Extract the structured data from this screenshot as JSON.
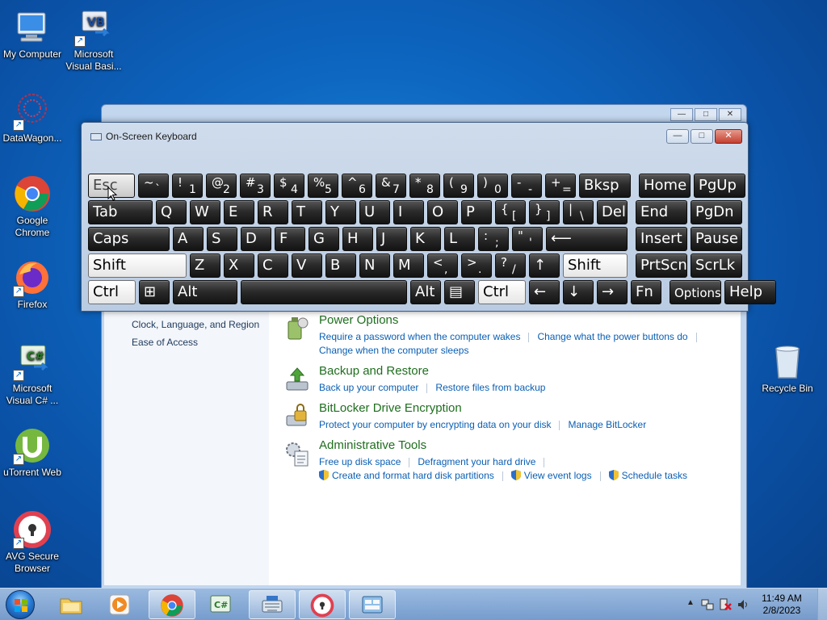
{
  "desktop": {
    "icons": [
      {
        "name": "my-computer",
        "label": "My Computer"
      },
      {
        "name": "visual-basic",
        "label": "Microsoft Visual Basi..."
      },
      {
        "name": "datawagon",
        "label": "DataWagon..."
      },
      {
        "name": "google-chrome",
        "label": "Google Chrome"
      },
      {
        "name": "firefox",
        "label": "Firefox"
      },
      {
        "name": "visual-csharp",
        "label": "Microsoft Visual C# ..."
      },
      {
        "name": "utorrent",
        "label": "uTorrent Web"
      },
      {
        "name": "avg-browser",
        "label": "AVG Secure Browser"
      },
      {
        "name": "recycle-bin",
        "label": "Recycle Bin"
      }
    ]
  },
  "control_panel": {
    "left_links": [
      "Clock, Language, and Region",
      "Ease of Access"
    ],
    "items": [
      {
        "title": "Power Options",
        "links": [
          "Require a password when the computer wakes",
          "Change what the power buttons do",
          "Change when the computer sleeps"
        ]
      },
      {
        "title": "Backup and Restore",
        "links": [
          "Back up your computer",
          "Restore files from backup"
        ]
      },
      {
        "title": "BitLocker Drive Encryption",
        "links": [
          "Protect your computer by encrypting data on your disk",
          "Manage BitLocker"
        ]
      },
      {
        "title": "Administrative Tools",
        "links": [
          "Free up disk space",
          "Defragment your hard drive",
          "Create and format hard disk partitions",
          "View event logs",
          "Schedule tasks"
        ]
      }
    ]
  },
  "osk": {
    "title": "On-Screen Keyboard",
    "caption_buttons": {
      "minimize": "—",
      "maximize": "□",
      "close": "✕"
    },
    "row1": [
      {
        "k": "esc",
        "label": "Esc"
      },
      {
        "k": "tilde",
        "up": "~",
        "down": "`"
      },
      {
        "k": "1",
        "up": "!",
        "down": "1"
      },
      {
        "k": "2",
        "up": "@",
        "down": "2"
      },
      {
        "k": "3",
        "up": "#",
        "down": "3"
      },
      {
        "k": "4",
        "up": "$",
        "down": "4"
      },
      {
        "k": "5",
        "up": "%",
        "down": "5"
      },
      {
        "k": "6",
        "up": "^",
        "down": "6"
      },
      {
        "k": "7",
        "up": "&",
        "down": "7"
      },
      {
        "k": "8",
        "up": "*",
        "down": "8"
      },
      {
        "k": "9",
        "up": "(",
        "down": "9"
      },
      {
        "k": "0",
        "up": ")",
        "down": "0"
      },
      {
        "k": "minus",
        "up": "-",
        "down": "-"
      },
      {
        "k": "equals",
        "up": "+",
        "down": "="
      },
      {
        "k": "bksp",
        "label": "Bksp"
      },
      {
        "k": "home",
        "label": "Home"
      },
      {
        "k": "pgup",
        "label": "PgUp"
      }
    ],
    "row2": [
      {
        "k": "tab",
        "label": "Tab"
      },
      {
        "k": "q",
        "label": "Q"
      },
      {
        "k": "w",
        "label": "W"
      },
      {
        "k": "e",
        "label": "E"
      },
      {
        "k": "r",
        "label": "R"
      },
      {
        "k": "t",
        "label": "T"
      },
      {
        "k": "y",
        "label": "Y"
      },
      {
        "k": "u",
        "label": "U"
      },
      {
        "k": "i",
        "label": "I"
      },
      {
        "k": "o",
        "label": "O"
      },
      {
        "k": "p",
        "label": "P"
      },
      {
        "k": "lbracket",
        "up": "{",
        "down": "["
      },
      {
        "k": "rbracket",
        "up": "}",
        "down": "]"
      },
      {
        "k": "backslash",
        "up": "|",
        "down": "\\"
      },
      {
        "k": "del",
        "label": "Del"
      },
      {
        "k": "end",
        "label": "End"
      },
      {
        "k": "pgdn",
        "label": "PgDn"
      }
    ],
    "row3": [
      {
        "k": "caps",
        "label": "Caps"
      },
      {
        "k": "a",
        "label": "A"
      },
      {
        "k": "s",
        "label": "S"
      },
      {
        "k": "d",
        "label": "D"
      },
      {
        "k": "f",
        "label": "F"
      },
      {
        "k": "g",
        "label": "G"
      },
      {
        "k": "h",
        "label": "H"
      },
      {
        "k": "j",
        "label": "J"
      },
      {
        "k": "k",
        "label": "K"
      },
      {
        "k": "l",
        "label": "L"
      },
      {
        "k": "semicolon",
        "up": ":",
        "down": ";"
      },
      {
        "k": "quote",
        "up": "\"",
        "down": "'"
      },
      {
        "k": "enter",
        "label": "⟵"
      },
      {
        "k": "insert",
        "label": "Insert"
      },
      {
        "k": "pause",
        "label": "Pause"
      }
    ],
    "row4": [
      {
        "k": "lshift",
        "label": "Shift"
      },
      {
        "k": "z",
        "label": "Z"
      },
      {
        "k": "x",
        "label": "X"
      },
      {
        "k": "c",
        "label": "C"
      },
      {
        "k": "v",
        "label": "V"
      },
      {
        "k": "b",
        "label": "B"
      },
      {
        "k": "n",
        "label": "N"
      },
      {
        "k": "m",
        "label": "M"
      },
      {
        "k": "comma",
        "up": "<",
        "down": ","
      },
      {
        "k": "period",
        "up": ">",
        "down": "."
      },
      {
        "k": "slash",
        "up": "?",
        "down": "/"
      },
      {
        "k": "uparrow",
        "label": "↑"
      },
      {
        "k": "rshift",
        "label": "Shift"
      },
      {
        "k": "prtscn",
        "label": "PrtScn"
      },
      {
        "k": "scrlk",
        "label": "ScrLk"
      }
    ],
    "row5": [
      {
        "k": "lctrl",
        "label": "Ctrl"
      },
      {
        "k": "win",
        "label": "⊞"
      },
      {
        "k": "lalt",
        "label": "Alt"
      },
      {
        "k": "space",
        "label": ""
      },
      {
        "k": "ralt",
        "label": "Alt"
      },
      {
        "k": "menu",
        "label": "▤"
      },
      {
        "k": "rctrl",
        "label": "Ctrl"
      },
      {
        "k": "leftarrow",
        "label": "←"
      },
      {
        "k": "downarrow",
        "label": "↓"
      },
      {
        "k": "rightarrow",
        "label": "→"
      },
      {
        "k": "fn",
        "label": "Fn"
      },
      {
        "k": "options",
        "label": "Options"
      },
      {
        "k": "help",
        "label": "Help"
      }
    ]
  },
  "taskbar": {
    "items": [
      "start",
      "file-explorer",
      "media-player",
      "google-chrome",
      "visual-csharp",
      "on-screen-keyboard",
      "avg-browser",
      "control-panel"
    ],
    "clock": {
      "time": "11:49 AM",
      "date": "2/8/2023"
    }
  }
}
